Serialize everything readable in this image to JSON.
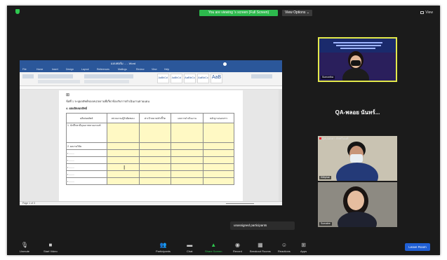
{
  "top": {
    "share_banner": "You are viewing 's screen (Full Screen)",
    "view_options": "View Options ⌄",
    "view": "View"
  },
  "doc": {
    "window_title": "แบบฟอร์ม ... - Word",
    "tabs": [
      "File",
      "Home",
      "Insert",
      "Design",
      "Layout",
      "References",
      "Mailings",
      "Review",
      "View",
      "Help"
    ],
    "styles": [
      "AaBbCcI",
      "AaBbCcI",
      "AaBbCc",
      "AaBbCc",
      "AaB"
    ],
    "question": "ข้อที่ 1 ระบุผลลัพธ์ของหน่วยงานที่เกี่ยวข้องกับการดำเนินงานตามแผน",
    "section": "4. ผลผลิต/ผลลัพธ์",
    "table_headers": [
      "ผลิต/ผลลัพธ์",
      "หน่วยงาน/ผู้รับผิดชอบ",
      "ค่าเป้าหมาย/ตัวชี้วัด",
      "ผลการดำเนินงาน",
      "หลักฐาน/เอกสาร"
    ],
    "row1": "1. นักศึกษามีคุณภาพตามเกณฑ์",
    "row2": "2. ผลงานวิจัย",
    "bullets": [
      "• ........",
      "• ........",
      "• ........",
      "• ........",
      "• ........"
    ],
    "status": "Page 1 of 3"
  },
  "participants": {
    "tile1_name": "Sumontha",
    "name_only": "QA-พลอย นันทร์...",
    "tile2_name": "Kittiphat",
    "tile2_label": "QA-เมตตา ภัยศรีนนท์",
    "tile3_name": "Sumalee"
  },
  "tooltip": "unassigned participants",
  "toolbar": {
    "unmute": "Unmute",
    "start_video": "Start Video",
    "participants": "Participants",
    "chat": "Chat",
    "share_screen": "Share Screen",
    "record": "Record",
    "breakout": "Breakout Rooms",
    "reactions": "Reactions",
    "apps": "Apps",
    "leave": "Leave Room"
  }
}
